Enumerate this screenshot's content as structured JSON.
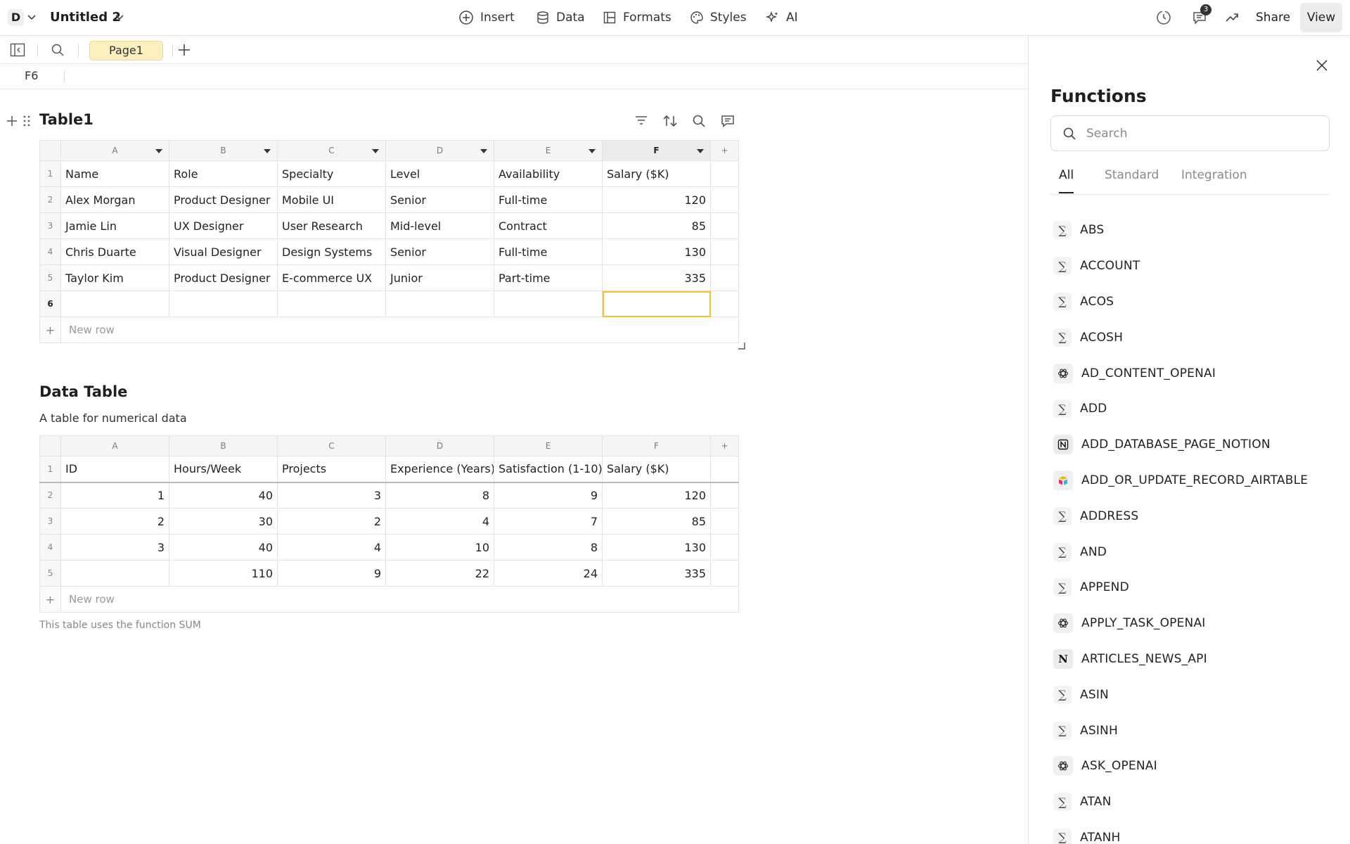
{
  "header": {
    "doc_badge": "D",
    "doc_title": "Untitled 2",
    "menu": {
      "insert": "Insert",
      "data": "Data",
      "formats": "Formats",
      "styles": "Styles",
      "ai": "AI"
    },
    "notifications_count": "3",
    "share": "Share",
    "view": "View"
  },
  "pages": {
    "active": "Page1"
  },
  "formula_bar": {
    "cell_ref": "F6"
  },
  "table1": {
    "title": "Table1",
    "columns": [
      "A",
      "B",
      "C",
      "D",
      "E",
      "F"
    ],
    "rows": [
      [
        "1",
        "Name",
        "Role",
        "Specialty",
        "Level",
        "Availability",
        "Salary ($K)"
      ],
      [
        "2",
        "Alex Morgan",
        "Product Designer",
        "Mobile UI",
        "Senior",
        "Full-time",
        "120"
      ],
      [
        "3",
        "Jamie Lin",
        "UX Designer",
        "User Research",
        "Mid-level",
        "Contract",
        "85"
      ],
      [
        "4",
        "Chris Duarte",
        "Visual Designer",
        "Design Systems",
        "Senior",
        "Full-time",
        "130"
      ],
      [
        "5",
        "Taylor Kim",
        "Product Designer",
        "E-commerce UX",
        "Junior",
        "Part-time",
        "335"
      ],
      [
        "6",
        "",
        "",
        "",
        "",
        "",
        ""
      ]
    ],
    "new_row": "New row"
  },
  "table2": {
    "title": "Data Table",
    "description": "A table for numerical data",
    "columns": [
      "A",
      "B",
      "C",
      "D",
      "E",
      "F"
    ],
    "rows": [
      [
        "1",
        "ID",
        "Hours/Week",
        "Projects",
        "Experience (Years)",
        "Satisfaction (1-10)",
        "Salary ($K)"
      ],
      [
        "2",
        "1",
        "40",
        "3",
        "8",
        "9",
        "120"
      ],
      [
        "3",
        "2",
        "30",
        "2",
        "4",
        "7",
        "85"
      ],
      [
        "4",
        "3",
        "40",
        "4",
        "10",
        "8",
        "130"
      ],
      [
        "5",
        "",
        "110",
        "9",
        "22",
        "24",
        "335"
      ]
    ],
    "new_row": "New row",
    "footnote": "This table uses the function SUM"
  },
  "functions_panel": {
    "title": "Functions",
    "search_placeholder": "Search",
    "tabs": [
      "All",
      "Standard",
      "Integration"
    ],
    "items": [
      {
        "name": "ABS",
        "icon": "sigma-icon"
      },
      {
        "name": "ACCOUNT",
        "icon": "sigma-icon"
      },
      {
        "name": "ACOS",
        "icon": "sigma-icon"
      },
      {
        "name": "ACOSH",
        "icon": "sigma-icon"
      },
      {
        "name": "AD_CONTENT_OPENAI",
        "icon": "openai-icon"
      },
      {
        "name": "ADD",
        "icon": "sigma-icon"
      },
      {
        "name": "ADD_DATABASE_PAGE_NOTION",
        "icon": "notion-icon"
      },
      {
        "name": "ADD_OR_UPDATE_RECORD_AIRTABLE",
        "icon": "airtable-icon"
      },
      {
        "name": "ADDRESS",
        "icon": "sigma-icon"
      },
      {
        "name": "AND",
        "icon": "sigma-icon"
      },
      {
        "name": "APPEND",
        "icon": "sigma-icon"
      },
      {
        "name": "APPLY_TASK_OPENAI",
        "icon": "openai-icon"
      },
      {
        "name": "ARTICLES_NEWS_API",
        "icon": "news-api-icon"
      },
      {
        "name": "ASIN",
        "icon": "sigma-icon"
      },
      {
        "name": "ASINH",
        "icon": "sigma-icon"
      },
      {
        "name": "ASK_OPENAI",
        "icon": "openai-icon"
      },
      {
        "name": "ATAN",
        "icon": "sigma-icon"
      },
      {
        "name": "ATANH",
        "icon": "sigma-icon"
      }
    ]
  },
  "colors": {
    "selection": "#f6c026",
    "page_tab_bg": "#fdf0c0"
  }
}
